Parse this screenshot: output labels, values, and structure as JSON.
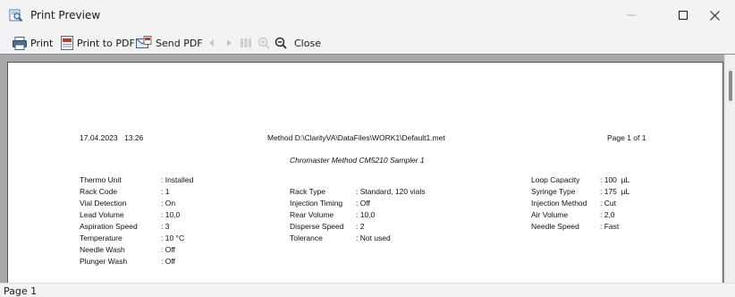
{
  "window": {
    "title": "Print Preview",
    "icon": "print-preview-icon"
  },
  "toolbar": {
    "print_label": "Print",
    "print_to_pdf_label": "Print to PDF",
    "send_pdf_label": "Send PDF",
    "close_label": "Close",
    "icons": [
      "printer-icon",
      "pdf-icon",
      "send-mail-icon",
      "prev-page-icon",
      "next-page-icon",
      "multi-page-icon",
      "zoom-in-icon",
      "zoom-out-icon"
    ]
  },
  "page": {
    "date": "17.04.2023",
    "time": "13:26",
    "method": "Method D:\\ClarityVA\\DataFiles\\WORK1\\Default1.met",
    "page_no": "Page 1 of 1",
    "title": "Chromaster Method CM5210 Sampler 1",
    "col1": [
      {
        "k": "Thermo Unit",
        "v": ": Installed"
      },
      {
        "k": "Rack Code",
        "v": ": 1"
      },
      {
        "k": "Vial Detection",
        "v": ": On"
      },
      {
        "k": "Lead Volume",
        "v": ": 10,0"
      },
      {
        "k": "Aspiration Speed",
        "v": ": 3"
      },
      {
        "k": "Temperature",
        "v": ": 10 °C"
      },
      {
        "k": "Needle Wash",
        "v": ": Off"
      },
      {
        "k": "Plunger Wash",
        "v": ": Off"
      }
    ],
    "col2": [
      {
        "k": "Rack Type",
        "v": ": Standard, 120 vials"
      },
      {
        "k": "Injection Timing",
        "v": ": Off"
      },
      {
        "k": "Rear Volume",
        "v": ": 10,0"
      },
      {
        "k": "Disperse Speed",
        "v": ": 2"
      },
      {
        "k": "Tolerance",
        "v": ": Not used"
      }
    ],
    "col3": [
      {
        "k": "Loop Capacity",
        "v": ": 100  µL"
      },
      {
        "k": "Syringe Type",
        "v": ": 175  µL"
      },
      {
        "k": "Injection Method",
        "v": ": Cut"
      },
      {
        "k": "Air Volume",
        "v": ": 2,0"
      },
      {
        "k": "Needle Speed",
        "v": ": Fast"
      }
    ]
  },
  "status": {
    "text": "Page 1"
  }
}
